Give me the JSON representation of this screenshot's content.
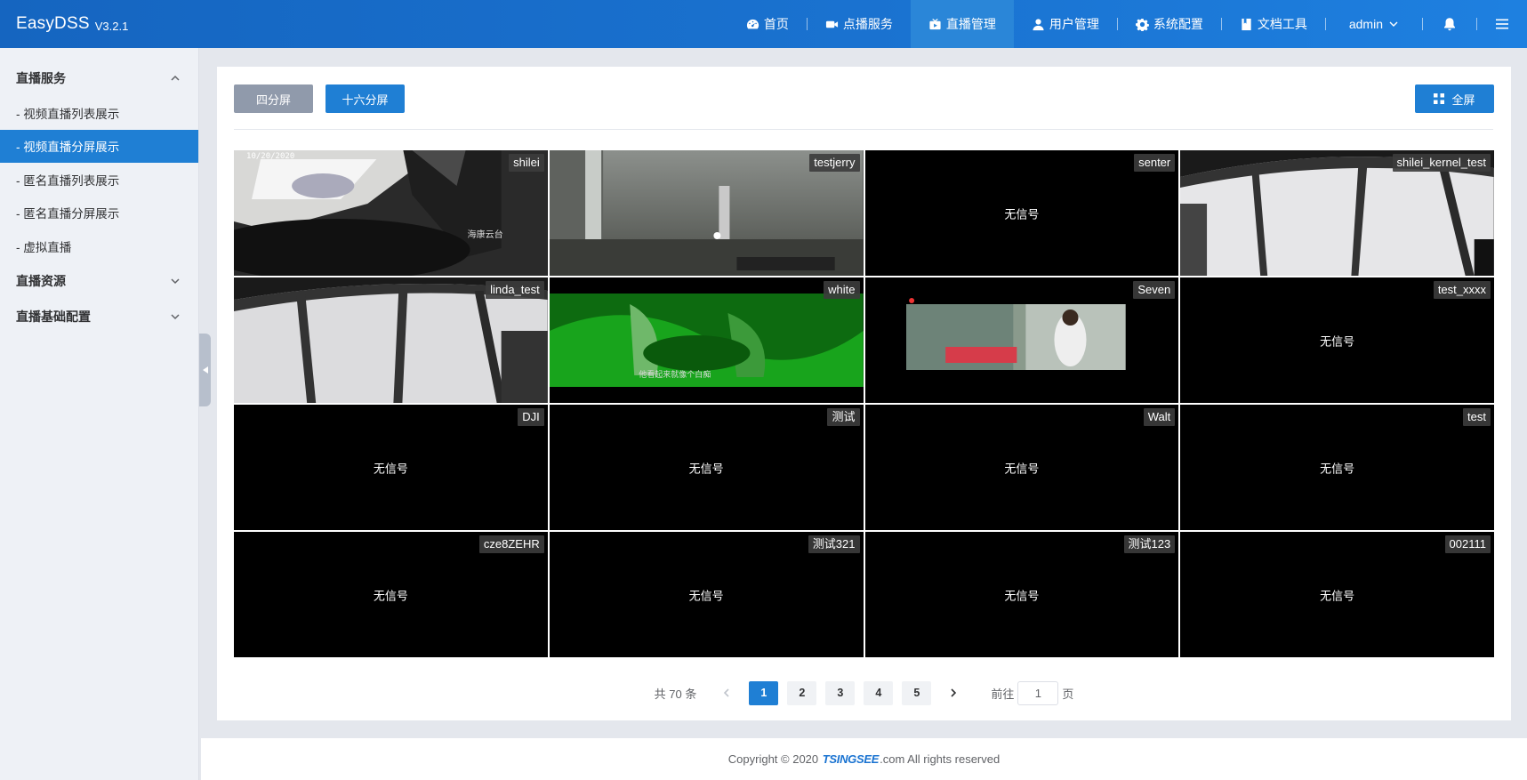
{
  "brand": {
    "name": "EasyDSS",
    "version": "V3.2.1"
  },
  "nav": [
    {
      "label": "首页",
      "icon": "gauge-icon",
      "active": false
    },
    {
      "label": "点播服务",
      "icon": "video-camera-icon",
      "active": false
    },
    {
      "label": "直播管理",
      "icon": "broadcast-icon",
      "active": true
    },
    {
      "label": "用户管理",
      "icon": "user-icon",
      "active": false
    },
    {
      "label": "系统配置",
      "icon": "gear-icon",
      "active": false
    },
    {
      "label": "文档工具",
      "icon": "book-icon",
      "active": false
    }
  ],
  "user": {
    "name": "admin"
  },
  "sidebar": {
    "groups": [
      {
        "label": "直播服务",
        "expanded": true,
        "items": [
          {
            "label": "- 视频直播列表展示",
            "active": false
          },
          {
            "label": "- 视频直播分屏展示",
            "active": true
          },
          {
            "label": "- 匿名直播列表展示",
            "active": false
          },
          {
            "label": "- 匿名直播分屏展示",
            "active": false
          },
          {
            "label": "- 虚拟直播",
            "active": false
          }
        ]
      },
      {
        "label": "直播资源",
        "expanded": false
      },
      {
        "label": "直播基础配置",
        "expanded": false
      }
    ]
  },
  "toolbar": {
    "four_split": "四分屏",
    "sixteen_split": "十六分屏",
    "fullscreen": "全屏"
  },
  "tiles": [
    {
      "name": "shilei",
      "status": "live"
    },
    {
      "name": "testjerry",
      "status": "live"
    },
    {
      "name": "senter",
      "status": "无信号"
    },
    {
      "name": "shilei_kernel_test",
      "status": "live"
    },
    {
      "name": "linda_test",
      "status": "live"
    },
    {
      "name": "white",
      "status": "live"
    },
    {
      "name": "Seven",
      "status": "live"
    },
    {
      "name": "test_xxxx",
      "status": "无信号"
    },
    {
      "name": "DJI",
      "status": "无信号"
    },
    {
      "name": "测试",
      "status": "无信号"
    },
    {
      "name": "Walt",
      "status": "无信号"
    },
    {
      "name": "test",
      "status": "无信号"
    },
    {
      "name": "cze8ZEHR",
      "status": "无信号"
    },
    {
      "name": "测试321",
      "status": "无信号"
    },
    {
      "name": "测试123",
      "status": "无信号"
    },
    {
      "name": "002111",
      "status": "无信号"
    }
  ],
  "overlay_text": {
    "shilei_stamp": "10/20/2020",
    "shilei_caption": "海康云台",
    "white_caption": "他看起来就像个白痴"
  },
  "pagination": {
    "total": "共 70 条",
    "pages": [
      "1",
      "2",
      "3",
      "4",
      "5"
    ],
    "current": "1",
    "goto_prefix": "前往",
    "goto_value": "1",
    "goto_suffix": "页"
  },
  "footer": {
    "prefix": "Copyright © 2020 ",
    "logo": "TSINGSEE",
    "suffix": ".com All rights reserved"
  },
  "colors": {
    "header": "#1a73d1",
    "accent": "#1f7fd4",
    "sidebar_bg": "#eef1f6",
    "no_signal_bg": "#000000"
  }
}
